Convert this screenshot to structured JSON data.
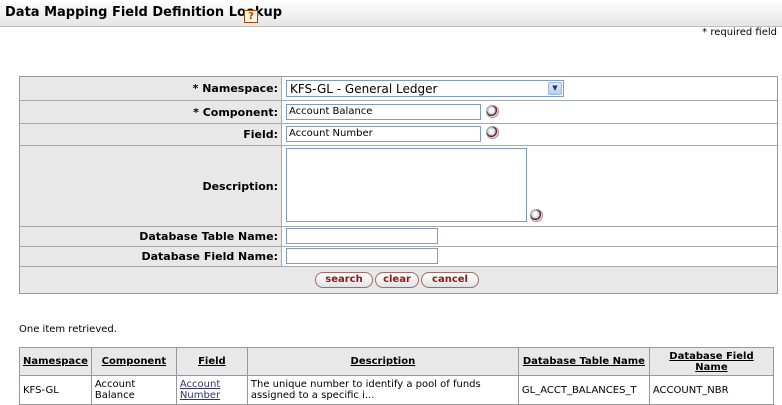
{
  "header": {
    "title": "Data Mapping Field Definition Lookup",
    "help_icon": "?",
    "required_note": "* required field"
  },
  "form": {
    "namespace": {
      "label": "*  Namespace:",
      "value": "KFS-GL - General Ledger"
    },
    "component": {
      "label": "*  Component:",
      "value": "Account Balance"
    },
    "field": {
      "label": "Field:",
      "value": "Account Number"
    },
    "description": {
      "label": "Description:",
      "value": ""
    },
    "db_table": {
      "label": "Database Table Name:",
      "value": ""
    },
    "db_field": {
      "label": "Database Field Name:",
      "value": ""
    }
  },
  "buttons": {
    "search": "search",
    "clear": "clear",
    "cancel": "cancel"
  },
  "results": {
    "count_text": "One item retrieved.",
    "headers": [
      "Namespace",
      "Component",
      "Field",
      "Description",
      "Database Table Name",
      "Database Field Name"
    ],
    "rows": [
      [
        "KFS-GL",
        "Account Balance",
        "Account Number",
        "The unique number to identify a pool of funds assigned to a specific i...",
        "GL_ACCT_BALANCES_T",
        "ACCOUNT_NBR"
      ]
    ]
  },
  "icons": {
    "help": "help-icon",
    "lookup": "magnifier-icon",
    "dropdown": "chevron-down-icon"
  }
}
